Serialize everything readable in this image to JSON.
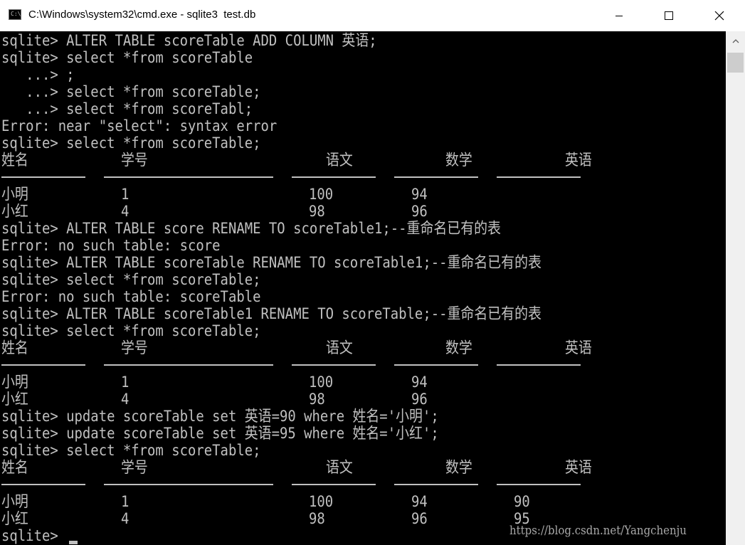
{
  "window": {
    "title": "C:\\Windows\\system32\\cmd.exe - sqlite3  test.db",
    "icon_label": "C:\\"
  },
  "console": {
    "lines": [
      "sqlite> ALTER TABLE scoreTable ADD COLUMN 英语;",
      "sqlite> select *from scoreTable",
      "   ...> ;",
      "   ...> select *from scoreTable;",
      "   ...> select *from scoreTabl;",
      "Error: near \"select\": syntax error",
      "sqlite> select *from scoreTable;"
    ],
    "lines_b": [
      "sqlite> ALTER TABLE score RENAME TO scoreTable1;--重命名已有的表",
      "Error: no such table: score",
      "sqlite> ALTER TABLE scoreTable RENAME TO scoreTable1;--重命名已有的表",
      "sqlite> select *from scoreTable;",
      "Error: no such table: scoreTable",
      "sqlite> ALTER TABLE scoreTable1 RENAME TO scoreTable;--重命名已有的表",
      "sqlite> select *from scoreTable;"
    ],
    "lines_c": [
      "sqlite> update scoreTable set 英语=90 where 姓名='小明';",
      "sqlite> update scoreTable set 英语=95 where 姓名='小红';",
      "sqlite> select *from scoreTable;"
    ],
    "prompt_last": "sqlite> "
  },
  "results": [
    {
      "headers": [
        "姓名",
        "学号",
        "语文",
        "数学",
        "英语"
      ],
      "rows": [
        [
          "小明",
          "1",
          "100",
          "94",
          ""
        ],
        [
          "小红",
          "4",
          "98",
          "96",
          ""
        ]
      ]
    },
    {
      "headers": [
        "姓名",
        "学号",
        "语文",
        "数学",
        "英语"
      ],
      "rows": [
        [
          "小明",
          "1",
          "100",
          "94",
          ""
        ],
        [
          "小红",
          "4",
          "98",
          "96",
          ""
        ]
      ]
    },
    {
      "headers": [
        "姓名",
        "学号",
        "语文",
        "数学",
        "英语"
      ],
      "rows": [
        [
          "小明",
          "1",
          "100",
          "94",
          "90"
        ],
        [
          "小红",
          "4",
          "98",
          "96",
          "95"
        ]
      ]
    }
  ],
  "watermark": "https://blog.csdn.net/Yangchenju",
  "colors": {
    "console_bg": "#000000",
    "console_text": "#c0c0c0",
    "titlebar_bg": "#ffffff",
    "scrollbar_bg": "#f0f0f0",
    "scrollbar_thumb": "#cdcdcd"
  }
}
